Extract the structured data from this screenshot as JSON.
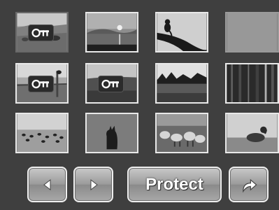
{
  "thumbnails": [
    {
      "scene": "field-with-animals",
      "protected": true,
      "selected": true
    },
    {
      "scene": "sun-over-lake",
      "protected": false,
      "selected": false
    },
    {
      "scene": "monkey-on-branch",
      "protected": false,
      "selected": false
    },
    {
      "scene": "blank-gray",
      "protected": false,
      "selected": false
    },
    {
      "scene": "bird-on-fence",
      "protected": true,
      "selected": false
    },
    {
      "scene": "lakeside",
      "protected": true,
      "selected": false
    },
    {
      "scene": "tree-line-meadow",
      "protected": false,
      "selected": false
    },
    {
      "scene": "dark-forest",
      "protected": false,
      "selected": false
    },
    {
      "scene": "flock-of-birds",
      "protected": false,
      "selected": false
    },
    {
      "scene": "fox-in-grass",
      "protected": false,
      "selected": false
    },
    {
      "scene": "sheep-herd",
      "protected": false,
      "selected": false
    },
    {
      "scene": "duck-on-water",
      "protected": false,
      "selected": false
    }
  ],
  "lock_icon": "key-lock-icon",
  "toolbar": {
    "prev_icon": "triangle-left-icon",
    "next_icon": "triangle-right-icon",
    "protect_label": "Protect",
    "return_icon": "curved-arrow-return-icon"
  },
  "colors": {
    "background": "#3f3f3f",
    "thumb_border": "#e8e8e8",
    "button_border": "#efefef",
    "button_text": "#ffffff"
  }
}
